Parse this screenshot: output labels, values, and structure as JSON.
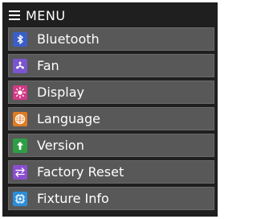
{
  "header": {
    "title": "MENU",
    "icon": "menu-icon"
  },
  "menu": {
    "items": [
      {
        "label": "Bluetooth",
        "icon": "bluetooth-icon",
        "color": "#3a5fc9"
      },
      {
        "label": "Fan",
        "icon": "fan-icon",
        "color": "#7a55cf"
      },
      {
        "label": "Display",
        "icon": "display-icon",
        "color": "#d23a86"
      },
      {
        "label": "Language",
        "icon": "language-icon",
        "color": "#e07b22"
      },
      {
        "label": "Version",
        "icon": "version-icon",
        "color": "#2e9e46"
      },
      {
        "label": "Factory Reset",
        "icon": "reset-icon",
        "color": "#8a4fcf"
      },
      {
        "label": "Fixture Info",
        "icon": "info-icon",
        "color": "#2a8fd8"
      }
    ]
  },
  "colors": {
    "background": "#1f1f1f",
    "item_background": "#585858",
    "text": "#ffffff"
  }
}
